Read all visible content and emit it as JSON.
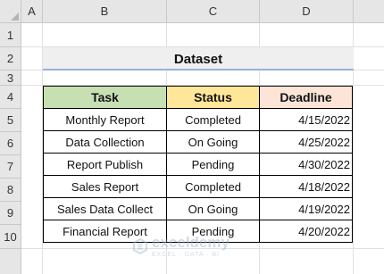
{
  "columns": [
    "A",
    "B",
    "C",
    "D"
  ],
  "rows": [
    "1",
    "2",
    "3",
    "4",
    "5",
    "6",
    "7",
    "8",
    "9",
    "10"
  ],
  "title": "Dataset",
  "table": {
    "headers": {
      "task": "Task",
      "status": "Status",
      "deadline": "Deadline"
    },
    "rows": [
      {
        "task": "Monthly Report",
        "status": "Completed",
        "deadline": "4/15/2022"
      },
      {
        "task": "Data Collection",
        "status": "On Going",
        "deadline": "4/25/2022"
      },
      {
        "task": "Report Publish",
        "status": "Pending",
        "deadline": "4/30/2022"
      },
      {
        "task": "Sales Report",
        "status": "Completed",
        "deadline": "4/18/2022"
      },
      {
        "task": "Sales Data Collect",
        "status": "On Going",
        "deadline": "4/19/2022"
      },
      {
        "task": "Financial Report",
        "status": "Pending",
        "deadline": "4/20/2022"
      }
    ]
  },
  "watermark": {
    "name": "exceldemy",
    "tagline": "EXCEL · DATA · BI",
    "icon": "exceldemy-logo-icon"
  },
  "colors": {
    "task_header": "#c6e0b4",
    "status_header": "#ffe699",
    "deadline_header": "#fce4d6",
    "title_underline": "#9ab0dc"
  }
}
